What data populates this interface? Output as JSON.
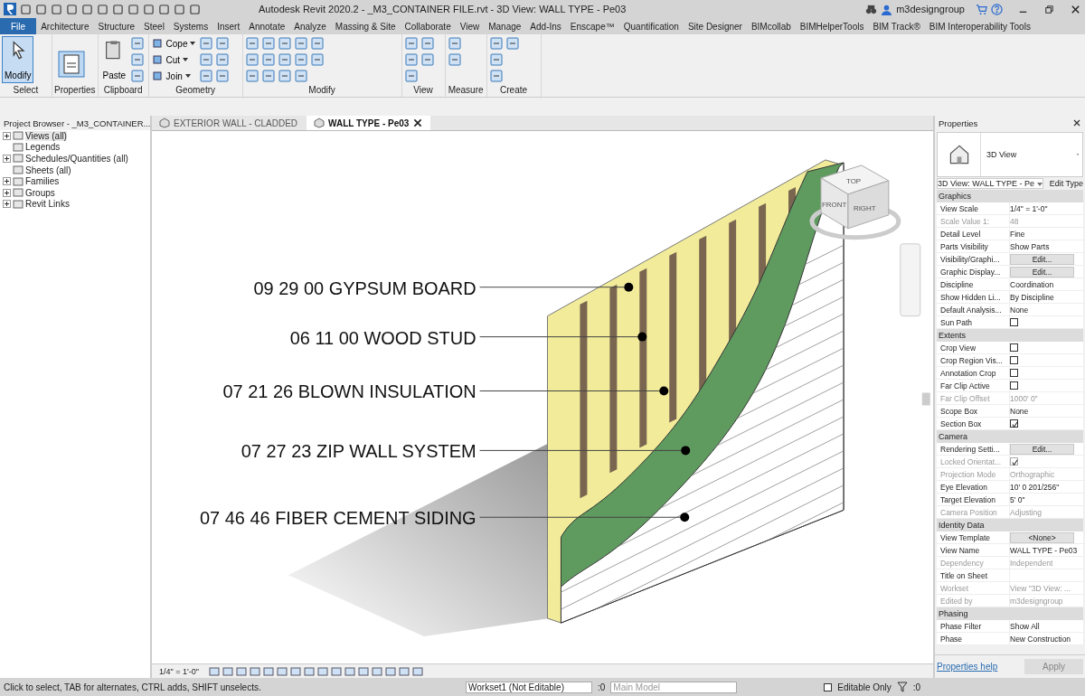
{
  "title_bar": {
    "title": "Autodesk Revit 2020.2 - _M3_CONTAINER FILE.rvt - 3D View: WALL TYPE - Pe03",
    "user": "m3designgroup"
  },
  "ribbon_tabs": [
    {
      "label": "File",
      "kind": "file"
    },
    {
      "label": "Architecture",
      "kind": "tab"
    },
    {
      "label": "Structure",
      "kind": "tab"
    },
    {
      "label": "Steel",
      "kind": "tab"
    },
    {
      "label": "Systems",
      "kind": "tab"
    },
    {
      "label": "Insert",
      "kind": "tab"
    },
    {
      "label": "Annotate",
      "kind": "tab"
    },
    {
      "label": "Analyze",
      "kind": "tab"
    },
    {
      "label": "Massing & Site",
      "kind": "tab"
    },
    {
      "label": "Collaborate",
      "kind": "tab"
    },
    {
      "label": "View",
      "kind": "tab"
    },
    {
      "label": "Manage",
      "kind": "tab"
    },
    {
      "label": "Add-Ins",
      "kind": "tab"
    },
    {
      "label": "Enscape™",
      "kind": "tab"
    },
    {
      "label": "Quantification",
      "kind": "tab"
    },
    {
      "label": "Site Designer",
      "kind": "tab"
    },
    {
      "label": "BIMcollab",
      "kind": "tab"
    },
    {
      "label": "BIMHelperTools",
      "kind": "tab"
    },
    {
      "label": "BIM Track®",
      "kind": "tab"
    },
    {
      "label": "BIM Interoperability Tools",
      "kind": "tab"
    }
  ],
  "ribbon_panels": [
    {
      "name": "Select",
      "tools": [
        {
          "kind": "large",
          "label": "Modify",
          "selected": true
        }
      ]
    },
    {
      "name": "Properties",
      "tools": [
        {
          "kind": "props"
        }
      ]
    },
    {
      "name": "Clipboard",
      "tools": [
        {
          "kind": "large",
          "label": "Paste",
          "selected": false
        }
      ]
    },
    {
      "name": "Geometry",
      "tools": [
        {
          "kind": "small",
          "label": "Cope"
        },
        {
          "kind": "small",
          "label": "Cut"
        },
        {
          "kind": "small",
          "label": "Join"
        }
      ]
    },
    {
      "name": "Modify"
    },
    {
      "name": "View"
    },
    {
      "name": "Measure"
    },
    {
      "name": "Create"
    }
  ],
  "project_browser": {
    "title": "Project Browser - _M3_CONTAINER...",
    "items": [
      {
        "label": "Views (all)",
        "kind": "group",
        "selected": true
      },
      {
        "label": "Legends",
        "kind": "leaf",
        "selected": false
      },
      {
        "label": "Schedules/Quantities (all)",
        "kind": "group",
        "selected": false
      },
      {
        "label": "Sheets (all)",
        "kind": "leaf",
        "selected": false
      },
      {
        "label": "Families",
        "kind": "group",
        "selected": false
      },
      {
        "label": "Groups",
        "kind": "group",
        "selected": false
      },
      {
        "label": "Revit Links",
        "kind": "group",
        "selected": false
      }
    ]
  },
  "view_tabs": [
    {
      "label": "EXTERIOR WALL - CLADDED",
      "selected": false
    },
    {
      "label": "WALL TYPE - Pe03",
      "selected": true
    }
  ],
  "view_cube": {
    "top": "TOP",
    "front": "FRONT",
    "right": "RIGHT"
  },
  "callouts": [
    {
      "label": "09 29 00 GYPSUM BOARD"
    },
    {
      "label": "06 11 00 WOOD STUD"
    },
    {
      "label": "07 21  26 BLOWN INSULATION"
    },
    {
      "label": "07 27 23 ZIP WALL SYSTEM"
    },
    {
      "label": "07 46 46 FIBER CEMENT SIDING"
    }
  ],
  "view_control_bar": {
    "scale": "1/4\" = 1'-0\""
  },
  "properties": {
    "title": "Properties",
    "type_name": "3D View",
    "selector": "3D View: WALL TYPE - Pe",
    "edit_type": "Edit Type",
    "groups": [
      {
        "name": "Graphics",
        "rows": [
          {
            "label": "View Scale",
            "value": "1/4\" = 1'-0\"",
            "kind": "text",
            "disabled": false
          },
          {
            "label": "Scale Value    1:",
            "value": "48",
            "kind": "text",
            "disabled": true
          },
          {
            "label": "Detail Level",
            "value": "Fine",
            "kind": "text",
            "disabled": false
          },
          {
            "label": "Parts Visibility",
            "value": "Show Parts",
            "kind": "text",
            "disabled": false
          },
          {
            "label": "Visibility/Graphi...",
            "value": "Edit...",
            "kind": "button",
            "disabled": false
          },
          {
            "label": "Graphic Display...",
            "value": "Edit...",
            "kind": "button",
            "disabled": false
          },
          {
            "label": "Discipline",
            "value": "Coordination",
            "kind": "text",
            "disabled": false
          },
          {
            "label": "Show Hidden Li...",
            "value": "By Discipline",
            "kind": "text",
            "disabled": false
          },
          {
            "label": "Default Analysis...",
            "value": "None",
            "kind": "text",
            "disabled": false
          },
          {
            "label": "Sun Path",
            "kind": "check",
            "checked": false,
            "disabled": false
          }
        ]
      },
      {
        "name": "Extents",
        "rows": [
          {
            "label": "Crop View",
            "kind": "check",
            "checked": false,
            "disabled": false
          },
          {
            "label": "Crop Region Vis...",
            "kind": "check",
            "checked": false,
            "disabled": false
          },
          {
            "label": "Annotation Crop",
            "kind": "check",
            "checked": false,
            "disabled": false
          },
          {
            "label": "Far Clip Active",
            "kind": "check",
            "checked": false,
            "disabled": false
          },
          {
            "label": "Far Clip Offset",
            "value": "1000'  0\"",
            "kind": "text",
            "disabled": true
          },
          {
            "label": "Scope Box",
            "value": "None",
            "kind": "text",
            "disabled": false
          },
          {
            "label": "Section Box",
            "kind": "check",
            "checked": true,
            "disabled": false
          }
        ]
      },
      {
        "name": "Camera",
        "rows": [
          {
            "label": "Rendering Setti...",
            "value": "Edit...",
            "kind": "button",
            "disabled": false
          },
          {
            "label": "Locked Orientat...",
            "kind": "check",
            "checked": true,
            "disabled": true
          },
          {
            "label": "Projection Mode",
            "value": "Orthographic",
            "kind": "text",
            "disabled": true
          },
          {
            "label": "Eye Elevation",
            "value": "10'  0 201/256\"",
            "kind": "text",
            "disabled": false
          },
          {
            "label": "Target Elevation",
            "value": "5'  0\"",
            "kind": "text",
            "disabled": false
          },
          {
            "label": "Camera Position",
            "value": "Adjusting",
            "kind": "text",
            "disabled": true
          }
        ]
      },
      {
        "name": "Identity Data",
        "rows": [
          {
            "label": "View Template",
            "value": "<None>",
            "kind": "button",
            "disabled": false
          },
          {
            "label": "View Name",
            "value": "WALL TYPE - Pe03",
            "kind": "text",
            "disabled": false
          },
          {
            "label": "Dependency",
            "value": "Independent",
            "kind": "text",
            "disabled": true
          },
          {
            "label": "Title on Sheet",
            "kind": "text",
            "disabled": false
          },
          {
            "label": "Workset",
            "value": "View \"3D View: ...",
            "kind": "text",
            "disabled": true
          },
          {
            "label": "Edited by",
            "value": "m3designgroup",
            "kind": "text",
            "disabled": true
          }
        ]
      },
      {
        "name": "Phasing",
        "rows": [
          {
            "label": "Phase Filter",
            "value": "Show All",
            "kind": "text",
            "disabled": false
          },
          {
            "label": "Phase",
            "value": "New Construction",
            "kind": "text",
            "disabled": false
          }
        ]
      }
    ],
    "help_link": "Properties help",
    "apply": {
      "label": "Apply",
      "disabled": true
    }
  },
  "status_bar": {
    "message": "Click to select, TAB for alternates, CTRL adds, SHIFT unselects.",
    "workset": "Workset1 (Not Editable)",
    "workset_count": ":0",
    "design_option": "Main Model",
    "editable_only": {
      "label": "Editable Only",
      "checked": false
    },
    "filter_count": ":0"
  }
}
